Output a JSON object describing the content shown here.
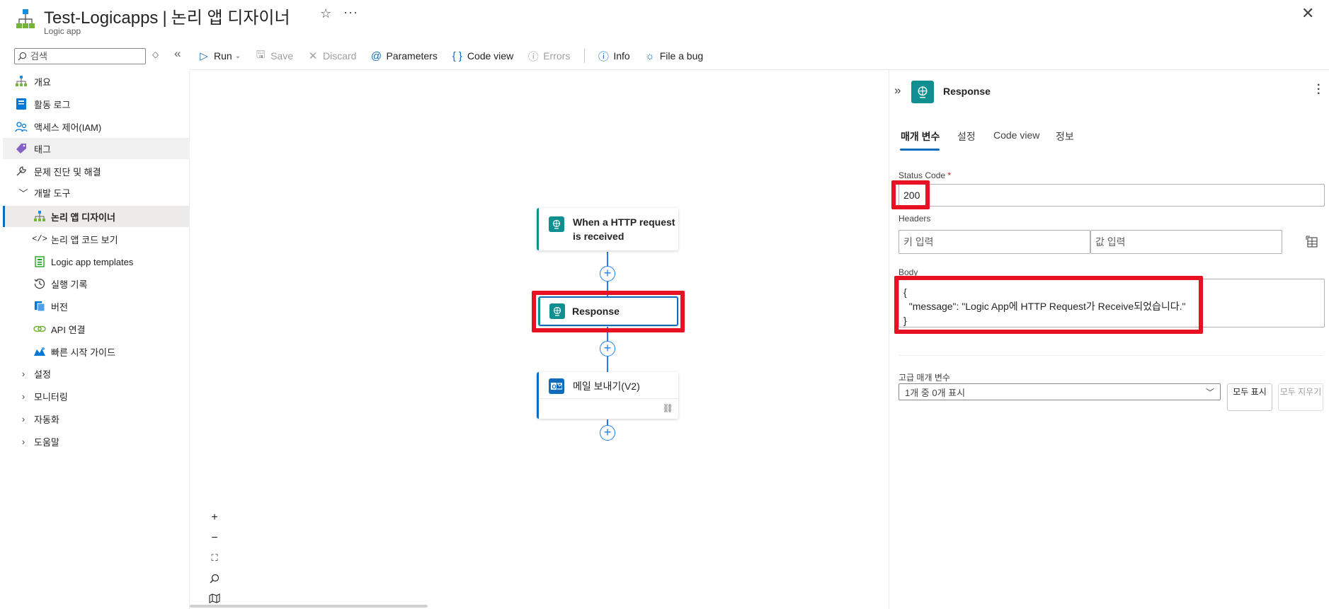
{
  "header": {
    "title": "Test-Logicapps",
    "separator": "|",
    "page": "논리 앱 디자이너",
    "subtitle": "Logic app"
  },
  "search": {
    "placeholder": "검색"
  },
  "sidebar": {
    "items": [
      {
        "label": "개요",
        "icon": "overview-icon"
      },
      {
        "label": "활동 로그",
        "icon": "activity-log-icon"
      },
      {
        "label": "액세스 제어(IAM)",
        "icon": "access-control-icon"
      },
      {
        "label": "태그",
        "icon": "tag-icon"
      },
      {
        "label": "문제 진단 및 해결",
        "icon": "wrench-icon"
      },
      {
        "label": "개발 도구",
        "icon": "chevron-down-icon"
      },
      {
        "label": "논리 앱 디자이너",
        "icon": "designer-icon"
      },
      {
        "label": "논리 앱 코드 보기",
        "icon": "code-icon"
      },
      {
        "label": "Logic app templates",
        "icon": "templates-icon"
      },
      {
        "label": "실행 기록",
        "icon": "history-icon"
      },
      {
        "label": "버전",
        "icon": "versions-icon"
      },
      {
        "label": "API 연결",
        "icon": "api-connection-icon"
      },
      {
        "label": "빠른 시작 가이드",
        "icon": "quickstart-icon"
      },
      {
        "label": "설정",
        "icon": "chevron-right-icon"
      },
      {
        "label": "모니터링",
        "icon": "chevron-right-icon"
      },
      {
        "label": "자동화",
        "icon": "chevron-right-icon"
      },
      {
        "label": "도움말",
        "icon": "chevron-right-icon"
      }
    ]
  },
  "toolbar": {
    "run": "Run",
    "save": "Save",
    "discard": "Discard",
    "parameters": "Parameters",
    "code_view": "Code view",
    "errors": "Errors",
    "info": "Info",
    "file_bug": "File a bug"
  },
  "canvas": {
    "trigger_title_line1": "When a HTTP request",
    "trigger_title_line2": "is received",
    "response_title": "Response",
    "email_title": "메일 보내기(V2)"
  },
  "panel": {
    "title": "Response",
    "tabs": [
      "매개 변수",
      "설정",
      "Code view",
      "정보"
    ],
    "status_code_label": "Status Code",
    "status_code_required": "*",
    "status_code_value": "200",
    "headers_label": "Headers",
    "header_key_placeholder": "키 입력",
    "header_value_placeholder": "값 입력",
    "body_label": "Body",
    "body_value": "{\n  \"message\": \"Logic App에 HTTP Request가 Receive되었습니다.\"\n}",
    "advanced_label": "고급 매개 변수",
    "advanced_select": "1개 중 0개 표시",
    "show_all": "모두 표시",
    "clear_all": "모두 지우기"
  },
  "colors": {
    "accent": "#0f6cbd",
    "connector": "#1b7ef6",
    "highlight": "#e81123",
    "action_teal": "#0f8f8f"
  }
}
